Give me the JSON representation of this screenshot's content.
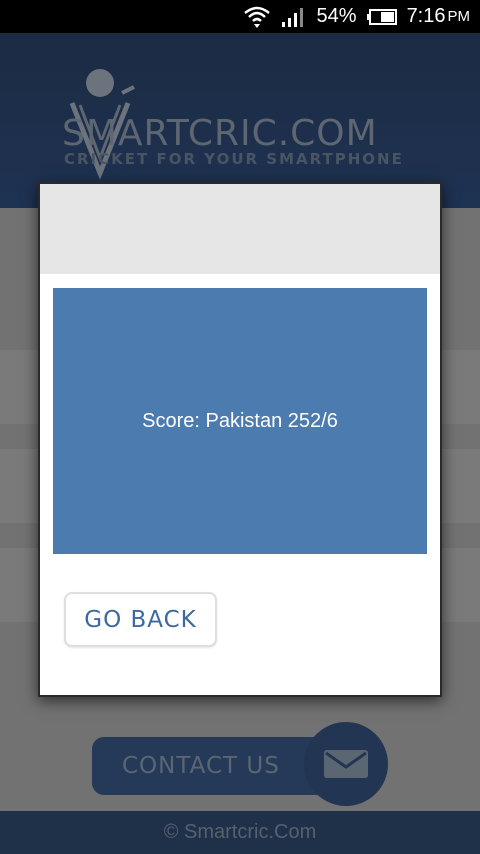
{
  "status_bar": {
    "battery": "54%",
    "time": "7:16",
    "ampm": "PM",
    "icons": [
      "wifi-icon",
      "signal-icon",
      "battery-icon"
    ]
  },
  "app": {
    "logo_text": "SMARTCRIC.COM",
    "tagline": "CRICKET FOR YOUR SMARTPHONE",
    "contact_label": "CONTACT US",
    "footer": "© Smartcric.Com"
  },
  "modal": {
    "score_text": "Score: Pakistan 252/6",
    "go_back_label": "GO BACK"
  },
  "colors": {
    "accent": "#4c7bb0",
    "header": "#1e3252",
    "button_text": "#3c6aa0"
  }
}
